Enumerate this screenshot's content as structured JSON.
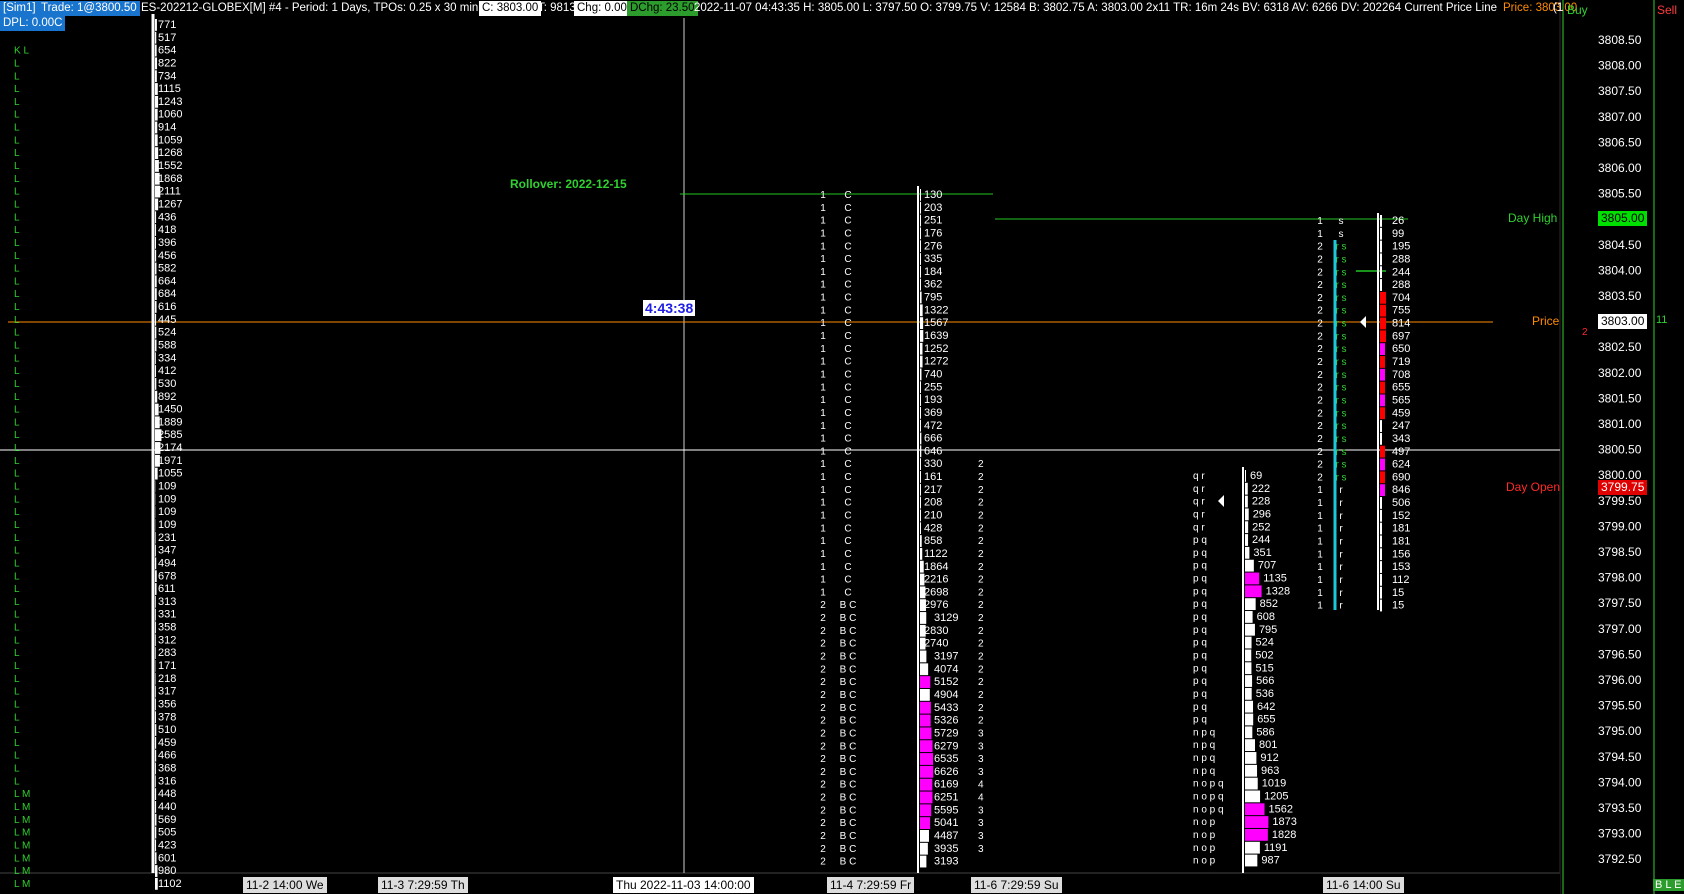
{
  "header": {
    "account": "[Sim1]",
    "trade": "Trade: 1@3800.50",
    "symbol_info": "ES-202212-GLOBEX[M]  #4 - Period: 1 Days, TPOs: 0.25 x 30 min",
    "close": "C: 3803.00",
    "trades": "T: 9813",
    "change": "Chg: 0.00",
    "dchg": "DChg: 23.50",
    "stats": "2022-11-07 04:43:35 H: 3805.00 L: 3797.50 O: 3799.75 V: 12584 B: 3802.75 A: 3803.00 2x11 TR: 16m 24s BV: 6318 AV: 6266 DV: 202264 Current Price Line",
    "price_label": "Price: 3803.00",
    "trailing": "(1",
    "dpl": "DPL: 0.00C",
    "buy_label": "Buy",
    "sell_label": "Sell"
  },
  "annotations": {
    "rollover": "Rollover: 2022-12-15",
    "timer": "4:43:38",
    "day_high": "Day High",
    "price": "Price",
    "day_open": "Day Open",
    "price_marker": "3803.00",
    "high_marker": "3805.00",
    "open_marker": "3799.75",
    "ask_qty": "11",
    "bid_qty": "2",
    "status": "B L E"
  },
  "price_axis": [
    "3808.50",
    "3808.00",
    "3807.50",
    "3807.00",
    "3806.50",
    "3806.00",
    "3805.50",
    "3805.00",
    "3804.50",
    "3804.00",
    "3803.50",
    "3803.00",
    "3802.50",
    "3802.00",
    "3801.50",
    "3801.00",
    "3800.50",
    "3800.00",
    "3799.50",
    "3799.00",
    "3798.50",
    "3798.00",
    "3797.50",
    "3797.00",
    "3796.50",
    "3796.00",
    "3795.50",
    "3795.00",
    "3794.50",
    "3794.00",
    "3793.50",
    "3793.00",
    "3792.50"
  ],
  "time_axis": [
    "11-2  14:00 We",
    "11-3  7:29:59 Th",
    "Thu 2022-11-03  14:00:00",
    "11-4  7:29:59 Fr",
    "11-6  7:29:59 Su",
    "11-6  14:00 Su"
  ],
  "profile1": {
    "letters": [
      "",
      "",
      "K L",
      "L",
      "L",
      "L",
      "L",
      "L",
      "L",
      "L",
      "L",
      "L",
      "L",
      "L",
      "L",
      "L",
      "L",
      "L",
      "L",
      "L",
      "L",
      "L",
      "L",
      "L",
      "L",
      "L",
      "L",
      "L",
      "L",
      "L",
      "L",
      "L",
      "L",
      "L",
      "L",
      "L",
      "L",
      "L",
      "L",
      "L",
      "L",
      "L",
      "L",
      "L",
      "L",
      "L",
      "L",
      "L",
      "L",
      "L",
      "L",
      "L",
      "L",
      "L",
      "L",
      "L",
      "L",
      "L",
      "L",
      "L",
      "L M",
      "L M",
      "L M",
      "L M",
      "L M",
      "L M",
      "L M",
      "L M"
    ],
    "volumes": [
      "771",
      "517",
      "654",
      "822",
      "734",
      "1115",
      "1243",
      "1060",
      "914",
      "1059",
      "1268",
      "1552",
      "1868",
      "2111",
      "1267",
      "436",
      "418",
      "396",
      "456",
      "582",
      "664",
      "684",
      "616",
      "445",
      "524",
      "588",
      "334",
      "412",
      "530",
      "892",
      "1450",
      "1889",
      "2585",
      "2174",
      "1971",
      "1055",
      "109",
      "109",
      "109",
      "109",
      "231",
      "347",
      "494",
      "678",
      "611",
      "313",
      "331",
      "358",
      "312",
      "283",
      "171",
      "218",
      "317",
      "356",
      "378",
      "510",
      "459",
      "466",
      "368",
      "316",
      "448",
      "440",
      "569",
      "505",
      "423",
      "601",
      "980",
      "1102"
    ]
  },
  "profile2": {
    "counts": [
      "1",
      "1",
      "1",
      "1",
      "1",
      "1",
      "1",
      "1",
      "1",
      "1",
      "1",
      "1",
      "1",
      "1",
      "1",
      "1",
      "1",
      "1",
      "1",
      "1",
      "1",
      "1",
      "1",
      "1",
      "1",
      "1",
      "1",
      "1",
      "1",
      "1",
      "1",
      "1",
      "2",
      "2",
      "2",
      "2",
      "2",
      "2",
      "2",
      "2",
      "2",
      "2",
      "2",
      "2",
      "2",
      "2",
      "2",
      "2",
      "2",
      "2",
      "2",
      "2",
      "2"
    ],
    "letters": [
      "C",
      "C",
      "C",
      "C",
      "C",
      "C",
      "C",
      "C",
      "C",
      "C",
      "C",
      "C",
      "C",
      "C",
      "C",
      "C",
      "C",
      "C",
      "C",
      "C",
      "C",
      "C",
      "C",
      "C",
      "C",
      "C",
      "C",
      "C",
      "C",
      "C",
      "C",
      "C",
      "B C",
      "B C",
      "B C",
      "B C",
      "B C",
      "B C",
      "B C",
      "B C",
      "B C",
      "B C",
      "B C",
      "B C",
      "B C",
      "B C",
      "B C",
      "B C",
      "B C",
      "B C",
      "B C",
      "B C",
      "B C"
    ],
    "volumes": [
      "130",
      "203",
      "251",
      "176",
      "276",
      "335",
      "184",
      "362",
      "795",
      "1322",
      "1567",
      "1639",
      "1252",
      "1272",
      "740",
      "255",
      "193",
      "369",
      "472",
      "666",
      "646",
      "330",
      "161",
      "217",
      "208",
      "210",
      "428",
      "858",
      "1122",
      "1864",
      "2216",
      "2698",
      "2976",
      "3129",
      "2830",
      "2740",
      "3197",
      "4074",
      "5152",
      "4904",
      "5433",
      "5326",
      "5729",
      "6279",
      "6535",
      "6626",
      "6169",
      "6251",
      "5595",
      "5041",
      "4487",
      "3935",
      "3193"
    ],
    "right_counts": [
      "2",
      "2",
      "2",
      "2",
      "2",
      "2",
      "2",
      "2",
      "2",
      "2",
      "2",
      "2",
      "2",
      "2",
      "2",
      "2",
      "2",
      "2",
      "2",
      "2",
      "2",
      "3",
      "3",
      "3",
      "3",
      "4",
      "4",
      "3",
      "3",
      "3",
      "3"
    ]
  },
  "profile3": {
    "letters": [
      "q r",
      "q r",
      "q r",
      "q r",
      "q r",
      "p q",
      "p q",
      "p q",
      "p q",
      "p q",
      "p q",
      "p q",
      "p q",
      "p q",
      "p q",
      "p q",
      "p q",
      "p q",
      "p q",
      "p q",
      "n  p q",
      "n  p q",
      "n  p q",
      "n  p q",
      "n o p q",
      "n o p q",
      "n o p q",
      "n o p",
      "n o p",
      "n o p",
      "n o p"
    ],
    "volumes": [
      "69",
      "222",
      "228",
      "296",
      "252",
      "244",
      "351",
      "707",
      "1135",
      "1328",
      "852",
      "608",
      "795",
      "524",
      "502",
      "515",
      "566",
      "536",
      "642",
      "655",
      "586",
      "801",
      "912",
      "963",
      "1019",
      "1205",
      "1562",
      "1873",
      "1828",
      "1191",
      "987"
    ]
  },
  "profile4": {
    "counts": [
      "1",
      "1",
      "2",
      "2",
      "2",
      "2",
      "2",
      "2",
      "2",
      "2",
      "2",
      "2",
      "2",
      "2",
      "2",
      "2",
      "2",
      "2",
      "2",
      "2",
      "2",
      "1",
      "1",
      "1",
      "1",
      "1",
      "1",
      "1",
      "1",
      "1",
      "1"
    ],
    "letters": [
      "s",
      "s",
      "r s",
      "r s",
      "r s",
      "r s",
      "r s",
      "r s",
      "r s",
      "r s",
      "r s",
      "r s",
      "r s",
      "r s",
      "r s",
      "r s",
      "r s",
      "r s",
      "r s",
      "r s",
      "r s",
      "r",
      "r",
      "r",
      "r",
      "r",
      "r",
      "r",
      "r",
      "r",
      "r"
    ],
    "volumes": [
      "26",
      "99",
      "195",
      "288",
      "244",
      "288",
      "704",
      "755",
      "814",
      "697",
      "650",
      "719",
      "708",
      "655",
      "565",
      "459",
      "247",
      "343",
      "497",
      "624",
      "690",
      "846",
      "506",
      "152",
      "181",
      "181",
      "156",
      "153",
      "112",
      "15",
      "15"
    ]
  }
}
